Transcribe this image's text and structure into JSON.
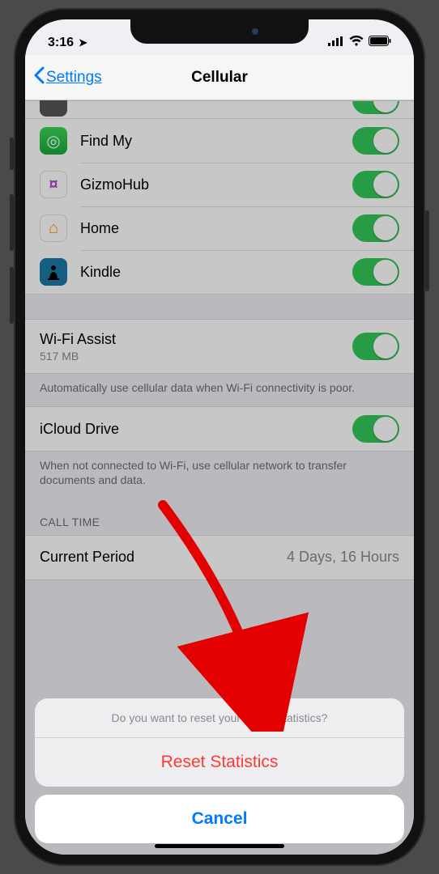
{
  "statusbar": {
    "time": "3:16",
    "location_icon": "➤"
  },
  "nav": {
    "back_label": "Settings",
    "title": "Cellular"
  },
  "apps": [
    {
      "name": "Find My",
      "icon_class": "ic-findmy",
      "icon_glyph": "◎",
      "icon_name": "findmy-icon"
    },
    {
      "name": "GizmoHub",
      "icon_class": "ic-gizmo",
      "icon_glyph": "¤",
      "icon_name": "gizmohub-icon"
    },
    {
      "name": "Home",
      "icon_class": "ic-home",
      "icon_glyph": "⌂",
      "icon_name": "home-icon"
    },
    {
      "name": "Kindle",
      "icon_class": "ic-kindle",
      "icon_glyph": "",
      "icon_name": "kindle-icon"
    }
  ],
  "wifi_assist": {
    "title": "Wi-Fi Assist",
    "usage": "517 MB",
    "footer": "Automatically use cellular data when Wi-Fi connectivity is poor."
  },
  "icloud": {
    "title": "iCloud Drive",
    "footer": "When not connected to Wi-Fi, use cellular network to transfer documents and data."
  },
  "calltime": {
    "header": "CALL TIME",
    "row_label": "Current Period",
    "row_value": "4 Days, 16 Hours"
  },
  "sheet": {
    "message": "Do you want to reset your usage statistics?",
    "action": "Reset Statistics",
    "cancel": "Cancel"
  }
}
